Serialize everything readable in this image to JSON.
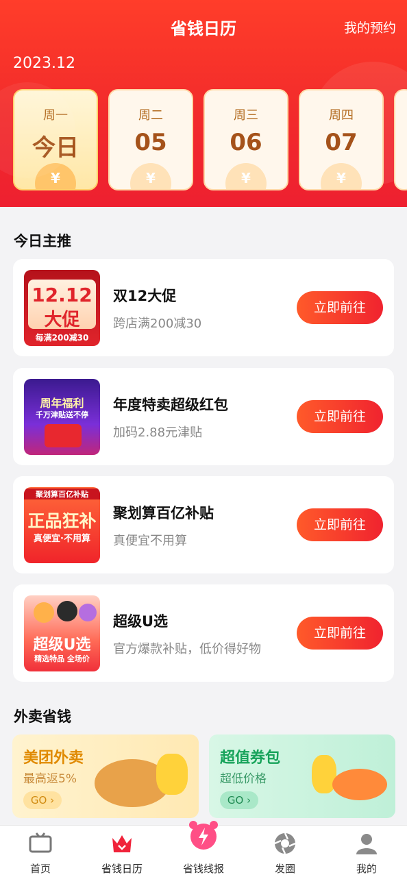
{
  "header": {
    "title": "省钱日历",
    "my_booking": "我的预约",
    "month": "2023.12"
  },
  "days": [
    {
      "week": "周一",
      "num": "今日"
    },
    {
      "week": "周二",
      "num": "05"
    },
    {
      "week": "周三",
      "num": "06"
    },
    {
      "week": "周四",
      "num": "07"
    }
  ],
  "coin_symbol": "¥",
  "main": {
    "section_title": "今日主推",
    "items": [
      {
        "title": "双12大促",
        "sub": "跨店满200减30",
        "button": "立即前往",
        "thumb_main": "12.12",
        "thumb_sub": "大促",
        "thumb_foot": "每满200减30"
      },
      {
        "title": "年度特卖超级红包",
        "sub": "加码2.88元津贴",
        "button": "立即前往",
        "thumb_main": "周年福利",
        "thumb_sub": "千万津贴送不停",
        "thumb_foot": ""
      },
      {
        "title": "聚划算百亿补贴",
        "sub": "真便宜不用算",
        "button": "立即前往",
        "thumb_main": "正品狂补",
        "thumb_sub": "真便宜·不用算",
        "thumb_foot": "聚划算百亿补贴"
      },
      {
        "title": "超级U选",
        "sub": "官方爆款补贴，低价得好物",
        "button": "立即前往",
        "thumb_main": "超级U选",
        "thumb_sub": "精选特品 全场价",
        "thumb_foot": ""
      }
    ]
  },
  "takeaway": {
    "section_title": "外卖省钱",
    "cards": [
      {
        "title": "美团外卖",
        "sub": "最高返5%",
        "go": "GO ›"
      },
      {
        "title": "超值券包",
        "sub": "超低价格",
        "go": "GO ›"
      }
    ]
  },
  "tabbar": [
    {
      "label": "首页",
      "icon": "tv-icon"
    },
    {
      "label": "省钱日历",
      "icon": "crown-icon"
    },
    {
      "label": "省钱线报",
      "icon": "alarm-bolt-icon"
    },
    {
      "label": "发圈",
      "icon": "aperture-icon"
    },
    {
      "label": "我的",
      "icon": "user-icon"
    }
  ],
  "colors": {
    "header": "#f22b2b",
    "accent": "#f0232f",
    "coin": "#ffc56a"
  }
}
